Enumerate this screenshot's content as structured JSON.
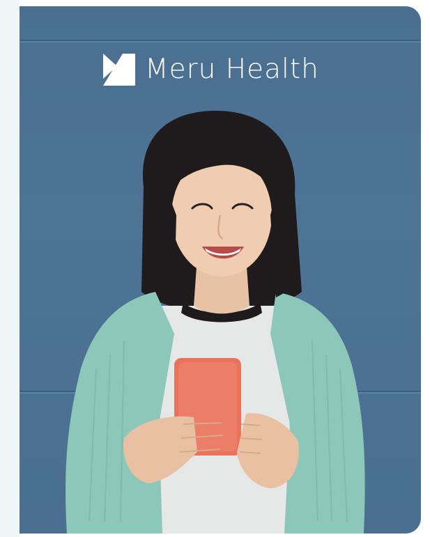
{
  "brand": {
    "name": "Meru Health",
    "logo_icon": "meru-health-logo-icon"
  },
  "hero_image": {
    "subject": "smiling-woman-with-phone-illustration"
  },
  "colors": {
    "background": "#4a6f91",
    "sidebar_strip": "#eef6f8",
    "cardigan": "#8cc7ba",
    "phone": "#e8735a",
    "brand_text": "#ffffff"
  }
}
